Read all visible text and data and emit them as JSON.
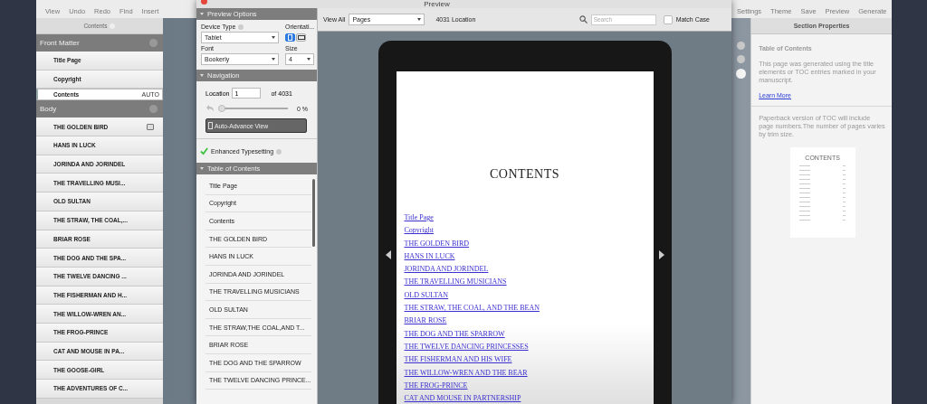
{
  "toolbar": {
    "left": [
      "View",
      "Undo",
      "Redo",
      "Find",
      "Insert"
    ],
    "right": [
      "Settings",
      "Theme",
      "Save",
      "Preview",
      "Generate"
    ]
  },
  "sidebar": {
    "title": "Contents",
    "sections": [
      {
        "title": "Front Matter",
        "items": [
          {
            "label": "Title Page",
            "selected": false,
            "marked": false
          },
          {
            "label": "Copyright",
            "selected": false,
            "marked": false
          },
          {
            "label": "Contents",
            "selected": true,
            "marked": false,
            "badge": "AUTO"
          }
        ]
      },
      {
        "title": "Body",
        "items": [
          {
            "label": "THE GOLDEN BIRD",
            "selected": false,
            "marked": true
          },
          {
            "label": "HANS IN LUCK",
            "selected": false,
            "marked": false
          },
          {
            "label": "JORINDA AND JORINDEL",
            "selected": false,
            "marked": false
          },
          {
            "label": "THE TRAVELLING MUSI...",
            "selected": false,
            "marked": false
          },
          {
            "label": "OLD SULTAN",
            "selected": false,
            "marked": false
          },
          {
            "label": "THE STRAW, THE COAL,...",
            "selected": false,
            "marked": false
          },
          {
            "label": "BRIAR ROSE",
            "selected": false,
            "marked": false
          },
          {
            "label": "THE DOG AND THE SPA...",
            "selected": false,
            "marked": false
          },
          {
            "label": "THE TWELVE DANCING ...",
            "selected": false,
            "marked": false
          },
          {
            "label": "THE FISHERMAN AND H...",
            "selected": false,
            "marked": false
          },
          {
            "label": "THE WILLOW-WREN AN...",
            "selected": false,
            "marked": false
          },
          {
            "label": "THE FROG-PRINCE",
            "selected": false,
            "marked": false
          },
          {
            "label": "CAT AND MOUSE IN PA...",
            "selected": false,
            "marked": false
          },
          {
            "label": "THE GOOSE-GIRL",
            "selected": false,
            "marked": false
          },
          {
            "label": "THE ADVENTURES OF C...",
            "selected": false,
            "marked": false
          }
        ]
      }
    ]
  },
  "preview": {
    "title": "Preview",
    "options": {
      "title": "Preview Options",
      "device_type_label": "Device Type",
      "device_type": "Tablet",
      "orientation_label": "Orientati...",
      "orientations": [
        {
          "kind": "portrait",
          "selected": true
        },
        {
          "kind": "landscape",
          "selected": false
        }
      ],
      "font_label": "Font",
      "font": "Bookerly",
      "size_label": "Size",
      "size": "4"
    },
    "navigation": {
      "title": "Navigation",
      "location_label": "Location",
      "location": "1",
      "of": "of 4031",
      "level": 0,
      "reading": "0 %",
      "button": "Auto-Advance View"
    },
    "enhanced": {
      "label": "Enhanced Typesetting",
      "checked": true
    },
    "toc": {
      "title": "Table of Contents",
      "items": [
        "Title Page",
        "Copyright",
        "Contents",
        "THE GOLDEN BIRD",
        "HANS IN LUCK",
        "JORINDA AND JORINDEL",
        "THE TRAVELLING MUSICIANS",
        "OLD SULTAN",
        "THE STRAW,THE COAL,AND T...",
        "BRIAR ROSE",
        "THE DOG AND THE SPARROW",
        "THE TWELVE DANCING PRINCE..."
      ]
    },
    "viewer": {
      "view_all": "View All",
      "view": "Pages",
      "location_count": "4031 Location",
      "search_placeholder": "Search",
      "match_case": {
        "label": "Match Case",
        "checked": false
      }
    },
    "page": {
      "heading": "CONTENTS",
      "links": [
        "Title Page",
        "Copyright",
        "THE GOLDEN BIRD",
        "HANS IN LUCK",
        "JORINDA AND JORINDEL",
        "THE TRAVELLING MUSICIANS",
        "OLD SULTAN",
        "THE STRAW, THE COAL, AND THE BEAN",
        "BRIAR ROSE",
        "THE DOG AND THE SPARROW",
        "THE TWELVE DANCING PRINCESSES",
        "THE FISHERMAN AND HIS WIFE",
        "THE WILLOW-WREN AND THE BEAR",
        "THE FROG-PRINCE",
        "CAT AND MOUSE IN PARTNERSHIP"
      ]
    }
  },
  "properties": {
    "title": "Section Properties",
    "heading": "Table of Contents",
    "text": "This page was generated using the title elements or TOC entries marked in your manuscript.",
    "link": "Learn More",
    "note": "Paperback version of TOC will include page numbers.The number of pages varies by trim size.",
    "thumbnail_title": "CONTENTS"
  }
}
